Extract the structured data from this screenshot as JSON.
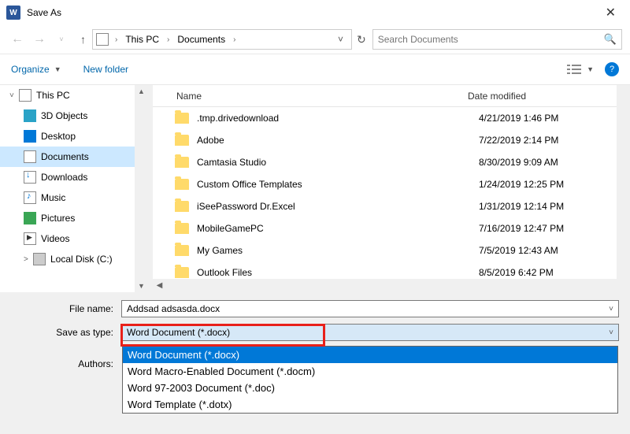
{
  "window": {
    "title": "Save As"
  },
  "breadcrumb": {
    "root": "This PC",
    "folder": "Documents"
  },
  "search": {
    "placeholder": "Search Documents"
  },
  "toolbar": {
    "organize": "Organize",
    "newfolder": "New folder"
  },
  "columns": {
    "name": "Name",
    "date": "Date modified"
  },
  "tree": [
    {
      "label": "This PC",
      "icon": "pc",
      "exp": "˅"
    },
    {
      "label": "3D Objects",
      "icon": "obj3d"
    },
    {
      "label": "Desktop",
      "icon": "desktop"
    },
    {
      "label": "Documents",
      "icon": "docs",
      "selected": true
    },
    {
      "label": "Downloads",
      "icon": "dl"
    },
    {
      "label": "Music",
      "icon": "music"
    },
    {
      "label": "Pictures",
      "icon": "pics"
    },
    {
      "label": "Videos",
      "icon": "vids"
    },
    {
      "label": "Local Disk (C:)",
      "icon": "disk",
      "exp": "˃"
    }
  ],
  "files": [
    {
      "name": ".tmp.drivedownload",
      "date": "4/21/2019 1:46 PM"
    },
    {
      "name": "Adobe",
      "date": "7/22/2019 2:14 PM"
    },
    {
      "name": "Camtasia Studio",
      "date": "8/30/2019 9:09 AM"
    },
    {
      "name": "Custom Office Templates",
      "date": "1/24/2019 12:25 PM"
    },
    {
      "name": "iSeePassword Dr.Excel",
      "date": "1/31/2019 12:14 PM"
    },
    {
      "name": "MobileGamePC",
      "date": "7/16/2019 12:47 PM"
    },
    {
      "name": "My Games",
      "date": "7/5/2019 12:43 AM"
    },
    {
      "name": "Outlook Files",
      "date": "8/5/2019 6:42 PM"
    }
  ],
  "form": {
    "filename_label": "File name:",
    "filename_value": "Addsad adsasda.docx",
    "type_label": "Save as type:",
    "type_value": "Word Document (*.docx)",
    "authors_label": "Authors:"
  },
  "type_options": [
    "Word Document (*.docx)",
    "Word Macro-Enabled Document (*.docm)",
    "Word 97-2003 Document (*.doc)",
    "Word Template (*.dotx)"
  ]
}
